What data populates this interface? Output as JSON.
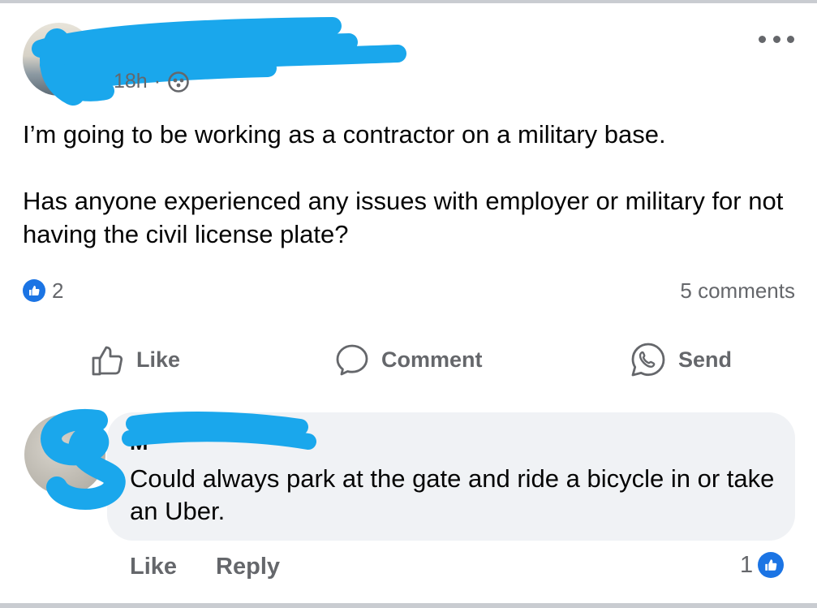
{
  "post": {
    "timestamp": "18h",
    "separator": "·",
    "audience_icon": "group-icon",
    "more_icon": "more-options-icon",
    "text_line1": "I’m going to be working as a contractor on a military base.",
    "text_line2": "Has anyone experienced any issues with employer or military for not having the civil license plate?",
    "reaction_icon": "like-reaction-icon",
    "reaction_count": "2",
    "comments_count": "5 comments"
  },
  "actions": {
    "like_label": "Like",
    "comment_label": "Comment",
    "send_label": "Send"
  },
  "comment": {
    "name": "M",
    "text": "Could always park at the gate and ride a bicycle in or take an Uber.",
    "like_label": "Like",
    "reply_label": "Reply",
    "reaction_count": "1"
  },
  "colors": {
    "accent": "#1b74e4",
    "muted_text": "#65676b",
    "bubble": "#f0f2f5",
    "redaction": "#1aa7ec"
  }
}
